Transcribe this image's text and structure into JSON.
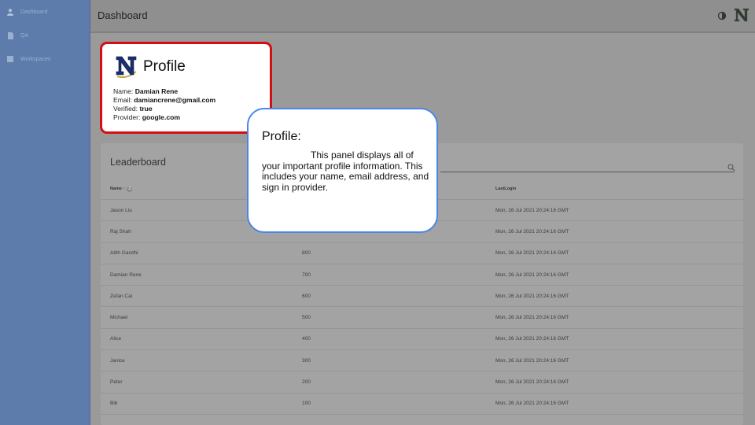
{
  "sidebar": {
    "items": [
      {
        "label": "Dashboard",
        "icon": "person-icon"
      },
      {
        "label": "QA",
        "icon": "document-icon"
      },
      {
        "label": "Workspaces",
        "icon": "grid-icon"
      }
    ]
  },
  "header": {
    "title": "Dashboard",
    "theme_icon": "theme-toggle-icon",
    "logo_icon": "n-logo-icon"
  },
  "profile": {
    "title": "Profile",
    "name_label": "Name:",
    "name": "Damian Rene",
    "email_label": "Email:",
    "email": "damiancrene@gmail.com",
    "verified_label": "Verified:",
    "verified": "true",
    "provider_label": "Provider:",
    "provider": "google.com"
  },
  "leaderboard": {
    "title": "Leaderboard",
    "columns": [
      "Name ↑",
      "",
      "LastLogin"
    ],
    "sort_badge": "2",
    "rows": [
      {
        "name": "Jason Liu",
        "score": "",
        "last": "Mon, 26 Jul 2021 20:24:16 GMT"
      },
      {
        "name": "Raj Shah",
        "score": "",
        "last": "Mon, 26 Jul 2021 20:24:16 GMT"
      },
      {
        "name": "Atith Gandhi",
        "score": "800",
        "last": "Mon, 26 Jul 2021 20:24:16 GMT"
      },
      {
        "name": "Damian Rene",
        "score": "700",
        "last": "Mon, 26 Jul 2021 20:24:16 GMT"
      },
      {
        "name": "Zefan Cai",
        "score": "600",
        "last": "Mon, 26 Jul 2021 20:24:16 GMT"
      },
      {
        "name": "Michael",
        "score": "500",
        "last": "Mon, 26 Jul 2021 20:24:16 GMT"
      },
      {
        "name": "Alice",
        "score": "400",
        "last": "Mon, 26 Jul 2021 20:24:16 GMT"
      },
      {
        "name": "Janice",
        "score": "300",
        "last": "Mon, 26 Jul 2021 20:24:16 GMT"
      },
      {
        "name": "Peter",
        "score": "200",
        "last": "Mon, 26 Jul 2021 20:24:16 GMT"
      },
      {
        "name": "Bib",
        "score": "100",
        "last": "Mon, 26 Jul 2021 20:24:16 GMT"
      }
    ]
  },
  "callout": {
    "title": "Profile:",
    "body": "This panel displays all of your important profile information. This includes your name, email address, and sign in provider."
  },
  "colors": {
    "sidebar": "#5d7cab",
    "profile_border": "#d30f15",
    "callout_border": "#4a86e8"
  }
}
